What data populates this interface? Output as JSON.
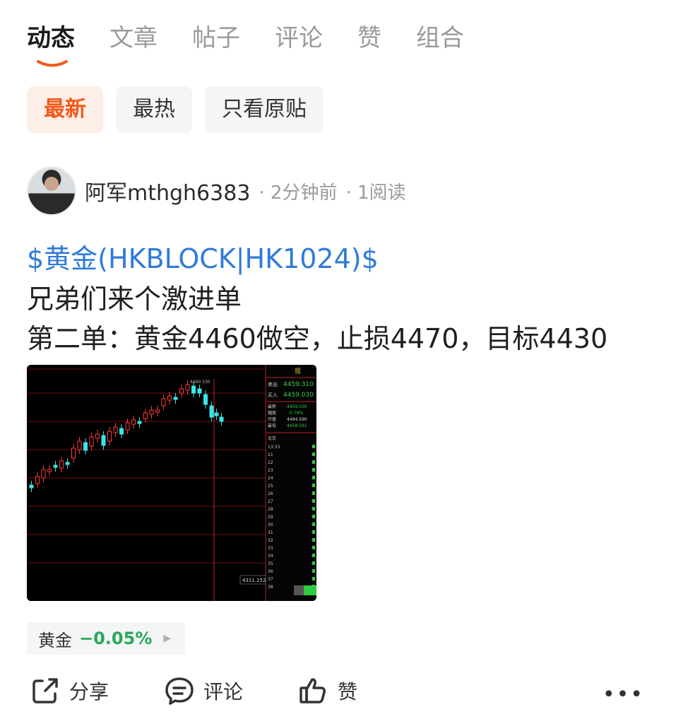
{
  "tabs": [
    {
      "label": "动态",
      "active": true
    },
    {
      "label": "文章",
      "active": false
    },
    {
      "label": "帖子",
      "active": false
    },
    {
      "label": "评论",
      "active": false
    },
    {
      "label": "赞",
      "active": false
    },
    {
      "label": "组合",
      "active": false
    }
  ],
  "filters": [
    {
      "label": "最新",
      "active": true
    },
    {
      "label": "最热",
      "active": false
    },
    {
      "label": "只看原贴",
      "active": false
    }
  ],
  "post": {
    "author": "阿军mthgh6383",
    "time": "· 2分钟前",
    "reads": "· 1阅读",
    "stock_link": "$黄金(HKBLOCK|HK1024)$",
    "line1": "兄弟们来个激进单",
    "line2": "第二单：黄金4460做空，止损4470，目标4430"
  },
  "chart_image": {
    "top_label": "4490.330",
    "bottom_label": "4311.152",
    "panel": {
      "header": "现",
      "sell_label": "卖出",
      "sell_value": "4459.310",
      "buy_label": "买入",
      "buy_value": "4459.030",
      "rows": [
        {
          "label": "最新",
          "value": "4459.030"
        },
        {
          "label": "幅度",
          "value": "-0.79%"
        },
        {
          "label": "开盘",
          "value": "4494.590"
        },
        {
          "label": "最低",
          "value": "4458.591"
        }
      ],
      "region": "北京",
      "times": [
        "13:33",
        "21",
        "22",
        "23",
        "24",
        "25",
        "26",
        "27",
        "28",
        "29",
        "30",
        "31",
        "32",
        "33",
        "34",
        "35",
        "36",
        "37",
        "38"
      ]
    }
  },
  "tag": {
    "name": "黄金",
    "change": "−0.05%",
    "arrow": "▶"
  },
  "actions": {
    "share": "分享",
    "comment": "评论",
    "like": "赞",
    "more": "•••"
  },
  "colors": {
    "accent": "#f25a1a",
    "link": "#2f7bd9",
    "down": "#2aa85a"
  }
}
